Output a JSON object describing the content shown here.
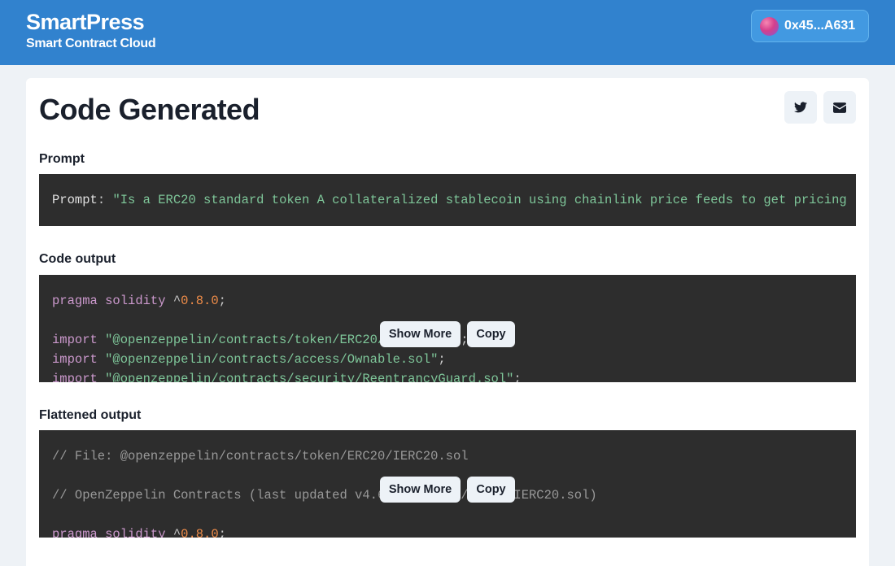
{
  "header": {
    "brand_title": "SmartPress",
    "brand_subtitle": "Smart Contract Cloud",
    "wallet_label": "0x45...A631",
    "color": "#3182ce"
  },
  "page": {
    "title": "Code Generated",
    "share": {
      "twitter_icon": "twitter-icon",
      "email_icon": "mail-icon"
    }
  },
  "prompt_section": {
    "label": "Prompt",
    "key": "Prompt",
    "colon": ":",
    "value": "\"Is a ERC20 standard token A collateralized stablecoin using chainlink price feeds to get pricing"
  },
  "code_section": {
    "label": "Code output",
    "line1_kw": "pragma solidity",
    "line1_caret": "^",
    "line1_num": "0.8.0",
    "line1_end": ";",
    "import_kw": "import",
    "import1": "\"@openzeppelin/contracts/token/ERC20/ERC20.sol\"",
    "import2": "\"@openzeppelin/contracts/access/Ownable.sol\"",
    "import3": "\"@openzeppelin/contracts/security/ReentrancyGuard.sol\"",
    "semi": ";",
    "show_more": "Show More",
    "copy": "Copy"
  },
  "flat_section": {
    "label": "Flattened output",
    "comment1": "// File: @openzeppelin/contracts/token/ERC20/IERC20.sol",
    "comment2": "// OpenZeppelin Contracts (last updated v4.6.0) (token/ERC20/IERC20.sol)",
    "line3_kw": "pragma solidity",
    "line3_caret": "^",
    "line3_num": "0.8.0",
    "line3_end": ";",
    "show_more": "Show More",
    "copy": "Copy"
  }
}
